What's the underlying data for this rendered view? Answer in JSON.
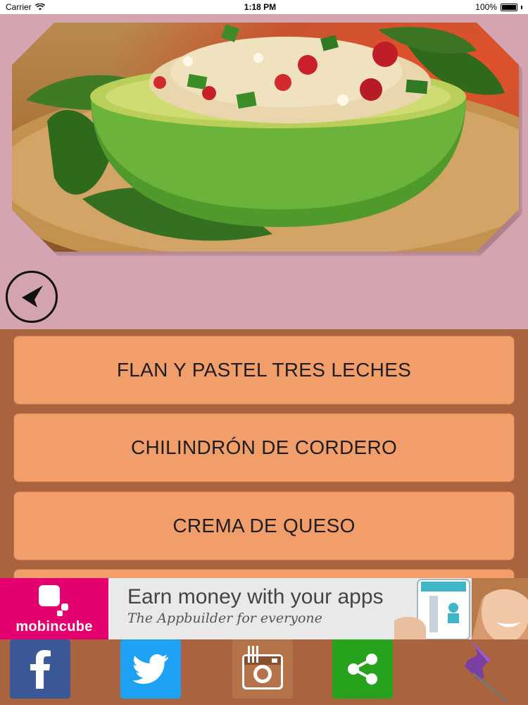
{
  "status_bar": {
    "carrier": "Carrier",
    "time": "1:18 PM",
    "battery": "100%"
  },
  "hero": {
    "icon": "stuffed-avocado-photo"
  },
  "back_button": {
    "icon": "back-arrow-icon"
  },
  "menu": {
    "items": [
      {
        "label": "FLAN Y PASTEL TRES LECHES"
      },
      {
        "label": "CHILINDRÓN DE CORDERO"
      },
      {
        "label": "CREMA DE QUESO"
      }
    ]
  },
  "ad": {
    "brand": "mobincube",
    "headline": "Earn money with your apps",
    "subline": "The Appbuilder for everyone"
  },
  "share_bar": {
    "buttons": [
      {
        "icon": "facebook-icon",
        "color": "#3b5998"
      },
      {
        "icon": "twitter-icon",
        "color": "#1da1f2"
      },
      {
        "icon": "instagram-icon",
        "color": "#b5734a"
      },
      {
        "icon": "share-icon",
        "color": "#27a21c"
      },
      {
        "icon": "pushpin-icon",
        "color": "#7a3fa0"
      }
    ]
  },
  "colors": {
    "header_bg": "#d4a4b0",
    "list_bg": "#a9643f",
    "menu_item_bg": "#f29e6b",
    "ad_brand": "#e5006f"
  }
}
